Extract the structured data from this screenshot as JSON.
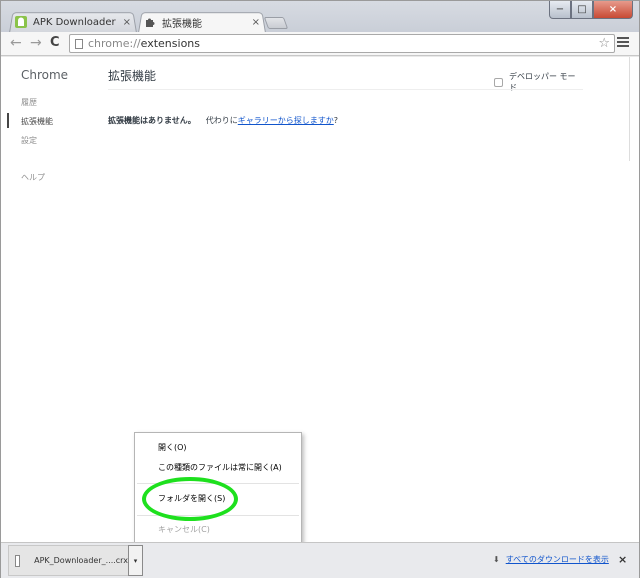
{
  "tabs": [
    {
      "title": "APK Downloader [Latest",
      "active": false
    },
    {
      "title": "拡張機能",
      "active": true
    }
  ],
  "tab_close_glyph": "×",
  "window_controls": {
    "minimize": "−",
    "maximize": "□",
    "close": "×"
  },
  "toolbar": {
    "back_glyph": "←",
    "forward_glyph": "→",
    "reload_glyph": "C",
    "url_scheme": "chrome://",
    "url_path": "extensions",
    "star_glyph": "☆"
  },
  "sidebar": {
    "title": "Chrome",
    "items": [
      {
        "label": "履歴",
        "selected": false
      },
      {
        "label": "拡張機能",
        "selected": true
      },
      {
        "label": "設定",
        "selected": false
      },
      {
        "label": "ヘルプ",
        "selected": false
      }
    ]
  },
  "main": {
    "title": "拡張機能",
    "developer_mode_label": "デベロッパー モード",
    "developer_mode_checked": false,
    "empty_message": "拡張機能はありません。",
    "alt_prefix": "代わりに",
    "gallery_link": "ギャラリーから探しますか",
    "alt_suffix": "?"
  },
  "context_menu": {
    "items": [
      {
        "label": "開く(O)",
        "enabled": true
      },
      {
        "label": "この種類のファイルは常に開く(A)",
        "enabled": true
      },
      {
        "label": "フォルダを開く(S)",
        "enabled": true
      },
      {
        "label": "キャンセル(C)",
        "enabled": false
      }
    ]
  },
  "download_shelf": {
    "file_name": "APK_Downloader_....crx",
    "dropdown_glyph": "▾",
    "show_all_link": "すべてのダウンロードを表示",
    "show_all_glyph": "⬇",
    "close_glyph": "×"
  },
  "colors": {
    "highlight": "#1ee01e",
    "link": "#1155cc"
  }
}
